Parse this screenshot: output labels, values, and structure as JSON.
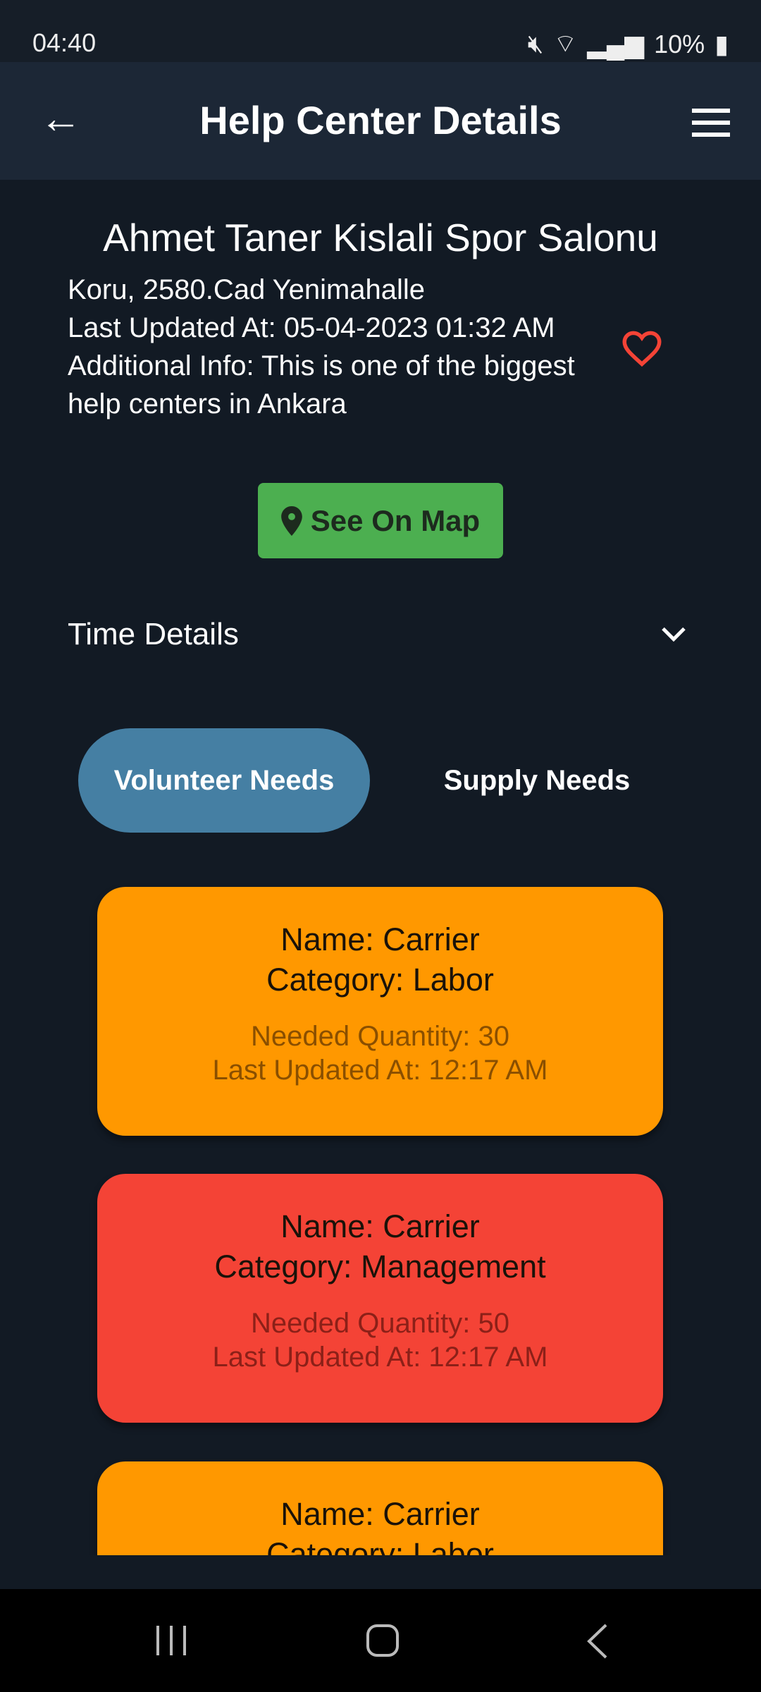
{
  "status_bar": {
    "time": "04:40",
    "battery": "10%"
  },
  "app_bar": {
    "title": "Help Center Details"
  },
  "center": {
    "name": "Ahmet Taner Kislali Spor Salonu",
    "address": "Koru, 2580.Cad Yenimahalle",
    "last_updated": "Last Updated At: 05-04-2023 01:32 AM",
    "additional_info": "Additional Info: This is one of the biggest help centers in Ankara",
    "favorite": false,
    "see_on_map_label": "See On Map"
  },
  "time_details": {
    "label": "Time Details",
    "expanded": false
  },
  "tabs": [
    {
      "label": "Volunteer Needs",
      "active": true
    },
    {
      "label": "Supply Needs",
      "active": false
    }
  ],
  "needs": [
    {
      "name": "Name: Carrier",
      "category": "Category: Labor",
      "quantity": "Needed Quantity: 30",
      "updated": "Last Updated At: 12:17 AM",
      "color": "#ff9800"
    },
    {
      "name": "Name: Carrier",
      "category": "Category: Management",
      "quantity": "Needed Quantity: 50",
      "updated": "Last Updated At: 12:17 AM",
      "color": "#f44336"
    },
    {
      "name": "Name: Carrier",
      "category": "Category: Labor",
      "color": "#ff9800"
    }
  ],
  "colors": {
    "accent": "#457fa3",
    "map_button": "#4caf50",
    "heart": "#f44336"
  }
}
